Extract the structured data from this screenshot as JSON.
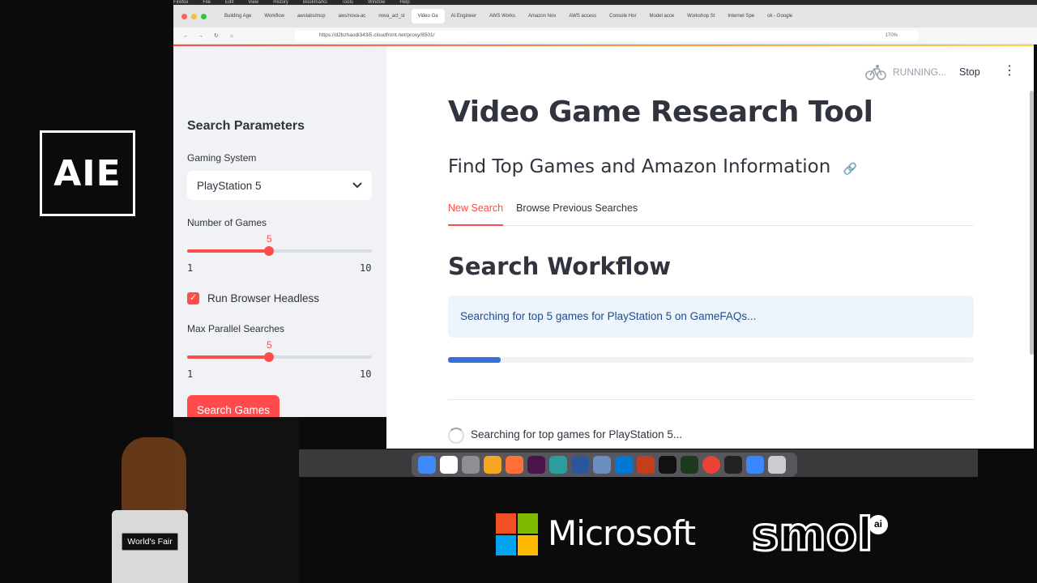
{
  "brand": {
    "aie_logo": "AIE"
  },
  "menubar": [
    "Firefox",
    "File",
    "Edit",
    "View",
    "History",
    "Bookmarks",
    "Tools",
    "Window",
    "Help"
  ],
  "browser": {
    "tabs": [
      "Building Age",
      "Workflow",
      "awslabs/mcp",
      "aws/nova-ac",
      "nova_act_st",
      "Video Ga",
      "AI Engineer",
      "AWS Works",
      "Amazon Nov",
      "AWS access",
      "Console Hor",
      "Model acce",
      "Workshop St",
      "Internet Spe",
      "ok - Google"
    ],
    "active_tab_index": 5,
    "url": "https://d2bzhaodi343i5.cloudfront.net/proxy/8501/",
    "zoom": "170%"
  },
  "app": {
    "status": "RUNNING...",
    "stop_label": "Stop",
    "title": "Video Game Research Tool",
    "subtitle": "Find Top Games and Amazon Information",
    "tabs": [
      {
        "label": "New Search",
        "active": true
      },
      {
        "label": "Browse Previous Searches",
        "active": false
      }
    ],
    "section_title": "Search Workflow",
    "info_message": "Searching for top 5 games for PlayStation 5 on GameFAQs...",
    "progress_fraction": 0.1,
    "spinner_text": "Searching for top games for PlayStation 5..."
  },
  "sidebar": {
    "title": "Search Parameters",
    "gaming_system": {
      "label": "Gaming System",
      "value": "PlayStation 5"
    },
    "num_games": {
      "label": "Number of Games",
      "value": "5",
      "min": "1",
      "max": "10",
      "fraction": 0.4444
    },
    "headless": {
      "label": "Run Browser Headless",
      "checked": true
    },
    "parallel": {
      "label": "Max Parallel Searches",
      "value": "5",
      "min": "1",
      "max": "10",
      "fraction": 0.4444
    },
    "search_button": "Search Games"
  },
  "presenter": {
    "podium_label": "World's Fair"
  },
  "sponsors": {
    "microsoft": "Microsoft",
    "smol": "smol",
    "smol_ai": "ai"
  },
  "colors": {
    "accent": "#ff4b4b",
    "progress": "#3a6fd8",
    "info_bg": "#eef4fb"
  }
}
